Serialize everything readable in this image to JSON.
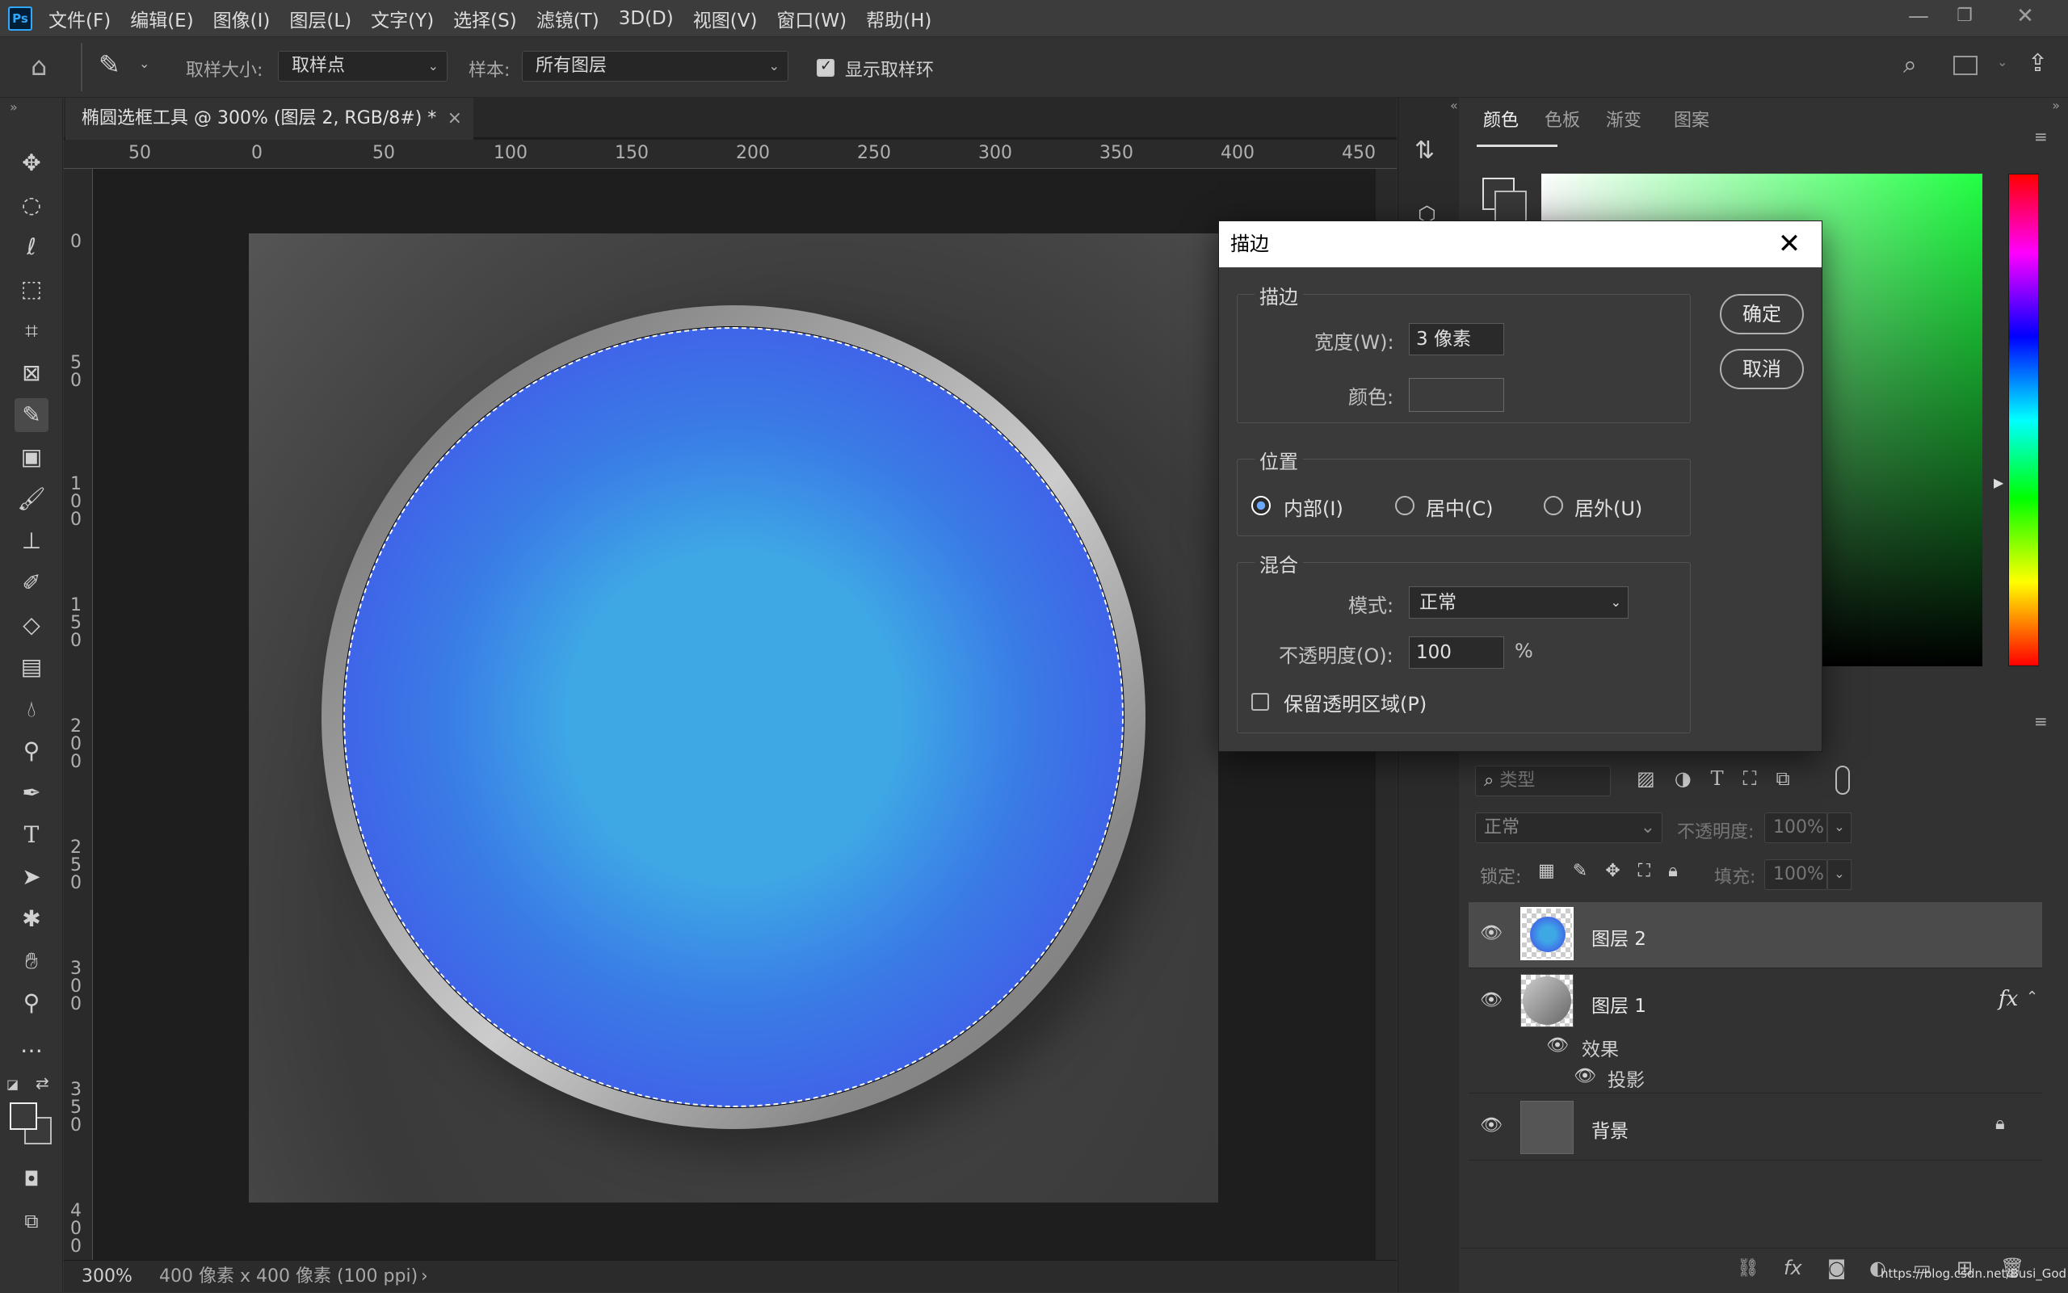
{
  "app": {
    "logo": "Ps"
  },
  "menu": [
    "文件(F)",
    "编辑(E)",
    "图像(I)",
    "图层(L)",
    "文字(Y)",
    "选择(S)",
    "滤镜(T)",
    "3D(D)",
    "视图(V)",
    "窗口(W)",
    "帮助(H)"
  ],
  "options": {
    "sample_size_label": "取样大小:",
    "sample_size_value": "取样点",
    "sample_label": "样本:",
    "sample_value": "所有图层",
    "show_ring_label": "显示取样环"
  },
  "document": {
    "tab_title": "椭圆选框工具 @ 300% (图层 2, RGB/8#) *",
    "ruler_h": [
      "50",
      "0",
      "50",
      "100",
      "150",
      "200",
      "250",
      "300",
      "350",
      "400",
      "450"
    ],
    "ruler_v": [
      "0",
      "5\n0",
      "1\n0\n0",
      "1\n5\n0",
      "2\n0\n0",
      "2\n5\n0",
      "3\n0\n0",
      "3\n5\n0",
      "4\n0\n0"
    ],
    "zoom": "300%",
    "doc_info": "400 像素 x 400 像素 (100 ppi)"
  },
  "color_panel": {
    "tabs": [
      "颜色",
      "色板",
      "渐变",
      "图案"
    ],
    "active_tab": "颜色"
  },
  "layers_panel": {
    "filter_placeholder": "类型",
    "blend_mode": "正常",
    "opacity_label": "不透明度:",
    "opacity_value": "100%",
    "lock_label": "锁定:",
    "fill_label": "填充:",
    "fill_value": "100%",
    "layers": [
      {
        "name": "图层 2",
        "selected": true
      },
      {
        "name": "图层 1",
        "fx": "fx",
        "effects_label": "效果",
        "effect": "投影"
      },
      {
        "name": "背景",
        "locked": true
      }
    ]
  },
  "watermark": "https://blog.csdn.net/Busi_God",
  "stroke_dialog": {
    "title": "描边",
    "stroke_group": "描边",
    "width_label": "宽度(W):",
    "width_value": "3 像素",
    "color_label": "颜色:",
    "swatch_color": "#3c3c3c",
    "position_group": "位置",
    "positions": [
      "内部(I)",
      "居中(C)",
      "居外(U)"
    ],
    "position_selected": "内部(I)",
    "blend_group": "混合",
    "mode_label": "模式:",
    "mode_value": "正常",
    "opacity_label": "不透明度(O):",
    "opacity_value": "100",
    "opacity_unit": "%",
    "preserve_label": "保留透明区域(P)",
    "ok": "确定",
    "cancel": "取消"
  }
}
